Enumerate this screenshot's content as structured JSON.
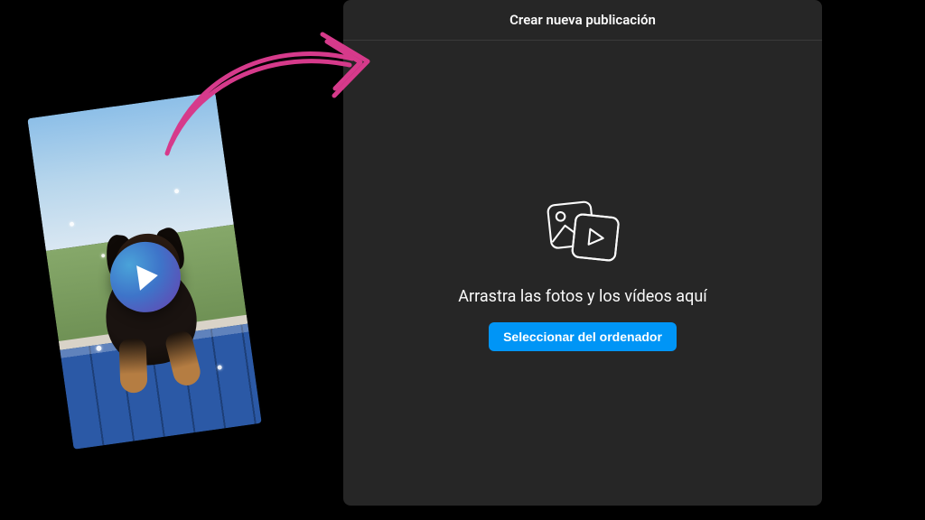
{
  "modal": {
    "title": "Crear nueva publicación",
    "drop_hint": "Arrastra las fotos y los vídeos aquí",
    "select_button": "Seleccionar del ordenador"
  },
  "thumbnail": {
    "icon": "play-icon"
  },
  "colors": {
    "accent": "#0095f6",
    "arrow": "#d63a8b"
  }
}
